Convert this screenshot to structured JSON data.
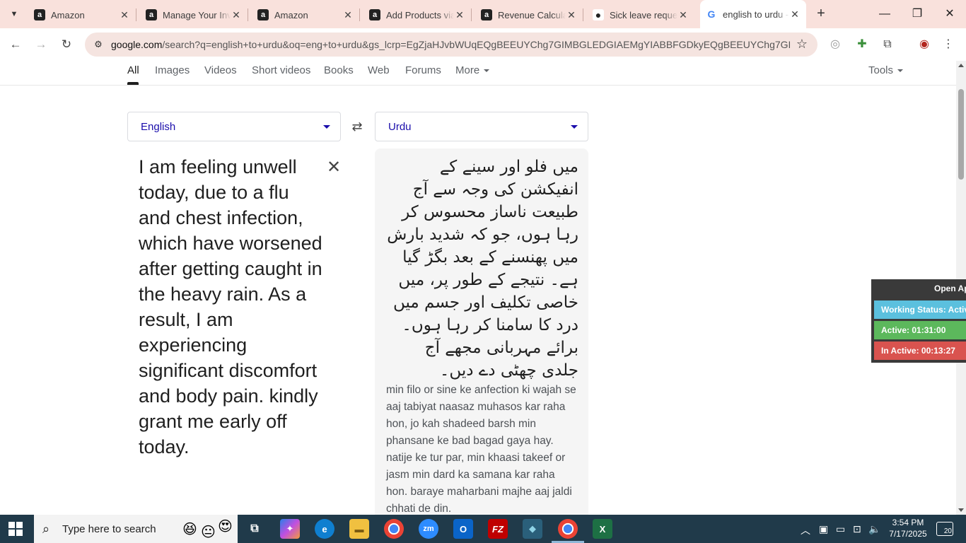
{
  "browser": {
    "tabs": [
      {
        "title": "Amazon",
        "favicon": "amazon-icon"
      },
      {
        "title": "Manage Your Inventory",
        "favicon": "amazon-icon"
      },
      {
        "title": "Amazon",
        "favicon": "amazon-icon"
      },
      {
        "title": "Add Products via Upload",
        "favicon": "amazon-icon"
      },
      {
        "title": "Revenue Calculator",
        "favicon": "amazon-icon"
      },
      {
        "title": "Sick leave request",
        "favicon": "github-icon"
      },
      {
        "title": "english to urdu - Google Search",
        "favicon": "google-icon"
      }
    ],
    "url_domain": "google.com",
    "url_rest": "/search?q=english+to+urdu&oq=eng+to+urdu&gs_lcrp=EgZjaHJvbWUqEQgBEEUYChg7GIMBGLEDGIAEMgYIABBFGDkyEQgBEEUYChg7GIM..."
  },
  "search_tabs": {
    "all": "All",
    "images": "Images",
    "videos": "Videos",
    "short_videos": "Short videos",
    "books": "Books",
    "web": "Web",
    "forums": "Forums",
    "more": "More",
    "tools": "Tools"
  },
  "translate": {
    "source_lang": "English",
    "target_lang": "Urdu",
    "source_text": "I am feeling unwell today, due to a flu and chest infection, which have worsened after getting caught in the heavy rain. As a result, I am experiencing significant discomfort and body pain. kindly grant me early off today.",
    "target_text": "میں فلو اور سینے کے انفیکشن کی وجہ سے آج طبیعت ناساز محسوس کر رہا ہوں، جو کہ شدید بارش میں پھنسنے کے بعد بگڑ گیا ہے۔ نتیجے کے طور پر، میں خاصی تکلیف اور جسم میں درد کا سامنا کر رہا ہوں۔ برائے مہربانی مجھے آج جلدی چھٹی دے دیں۔",
    "transliteration": "min filo or sine ke anfection ki wajah se aaj tabiyat naasaz muhasos kar raha hon, jo kah shadeed barsh min phansane ke bad bagad gaya hay. natije ke tur par, min khaasi takeef or jasm min dard ka samana kar raha hon. baraye maharbani majhe aaj jaldi chhati de din."
  },
  "widget": {
    "open_label": "Open Ap",
    "working_status": "Working Status: Active",
    "active": "Active: 01:31:00",
    "inactive": "In Active: 00:13:27",
    "colors": {
      "status": "#5bc0de",
      "active": "#5cb85c",
      "inactive": "#d9534f"
    }
  },
  "taskbar": {
    "search_placeholder": "Type here to search",
    "time": "3:54 PM",
    "date": "7/17/2025",
    "notifications": "20"
  }
}
